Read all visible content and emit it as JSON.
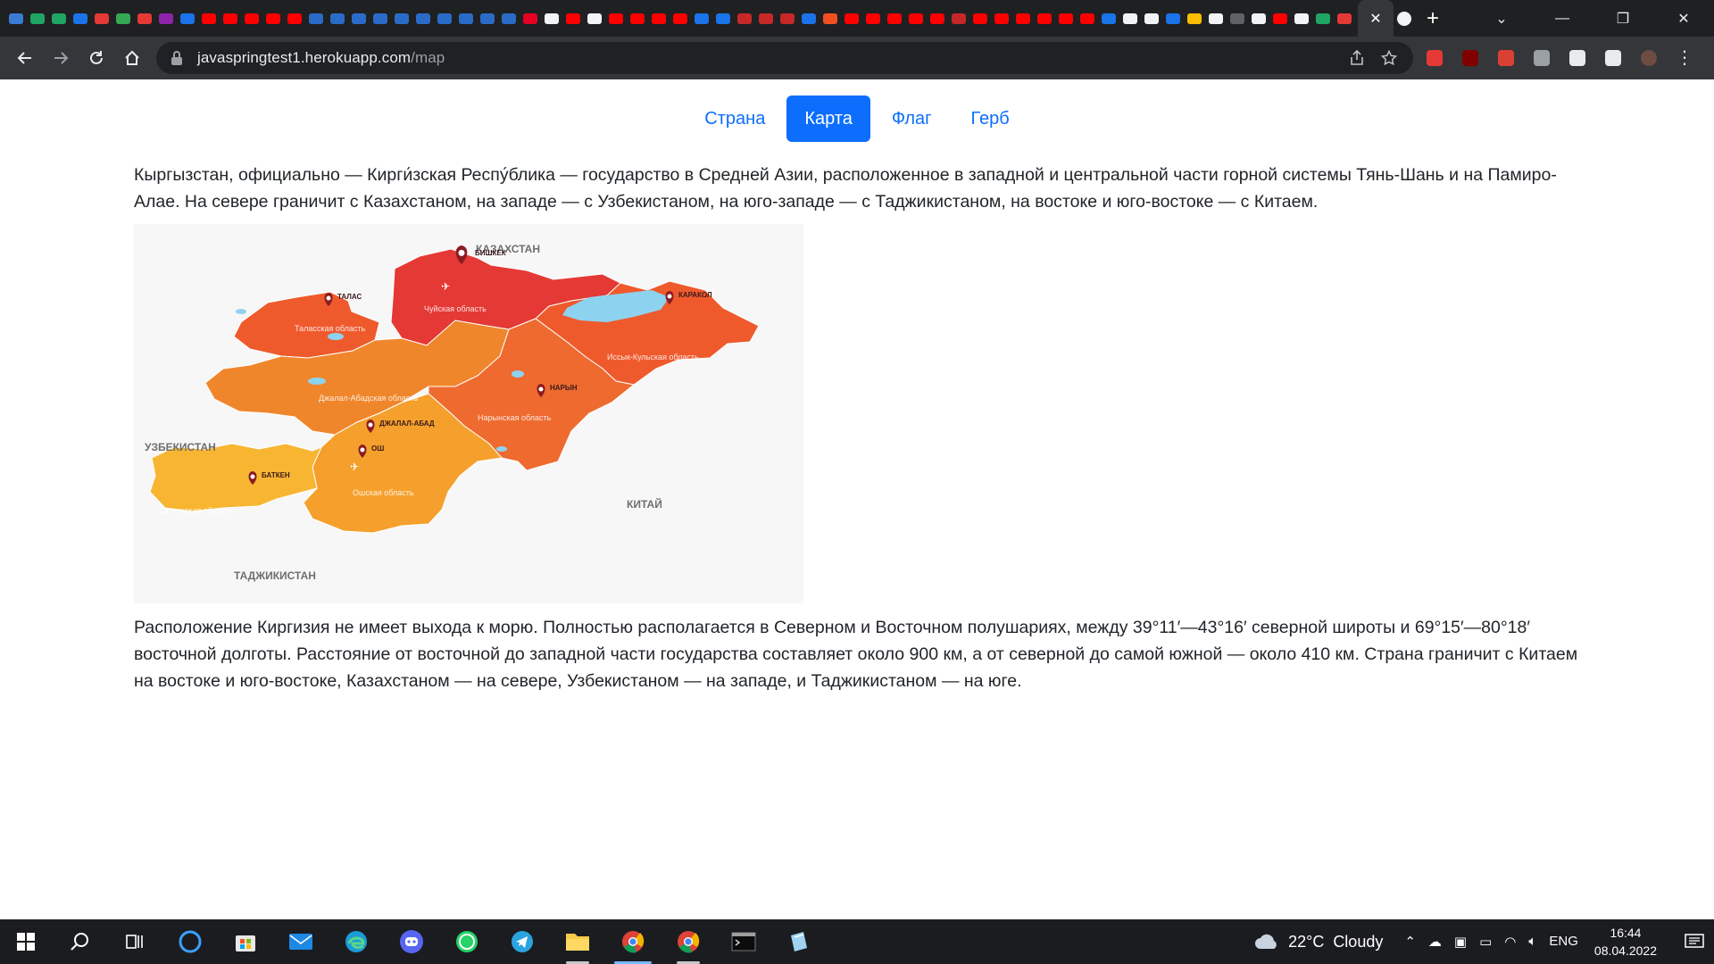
{
  "browser": {
    "active_tab_close": "✕",
    "new_tab": "+",
    "window_controls": {
      "dropdown": "⌄",
      "minimize": "—",
      "maximize": "❐",
      "close": "✕"
    },
    "url_host": "javaspringtest1.herokuapp.com",
    "url_path": "/map",
    "tab_favicon_colors": [
      "#3a7bd5",
      "#1fa463",
      "#1fa463",
      "#1a73e8",
      "#e53935",
      "#34a853",
      "#e53935",
      "#8e24aa",
      "#1a73e8",
      "#ff0000",
      "#ff0000",
      "#ff0000",
      "#ff0000",
      "#ff0000",
      "#2a6bc8",
      "#2a6bc8",
      "#2a6bc8",
      "#2a6bc8",
      "#2a6bc8",
      "#2a6bc8",
      "#2a6bc8",
      "#2a6bc8",
      "#2a6bc8",
      "#2a6bc8",
      "#e60023",
      "#f1f3f4",
      "#ff0000",
      "#f1f3f4",
      "#ff0000",
      "#ff0000",
      "#ff0000",
      "#ff0000",
      "#1a73e8",
      "#1a73e8",
      "#c62828",
      "#c62828",
      "#c62828",
      "#1a73e8",
      "#f25022",
      "#ff0000",
      "#ff0000",
      "#ff0000",
      "#ff0000",
      "#ff0000",
      "#c62828",
      "#ff0000",
      "#ff0000",
      "#ff0000",
      "#ff0000",
      "#ff0000",
      "#ff0000",
      "#1a73e8",
      "#f1f3f4",
      "#f1f3f4",
      "#1a73e8",
      "#fbbc04",
      "#f1f3f4",
      "#5f6368",
      "#f1f3f4",
      "#ff0000",
      "#f1f3f4",
      "#1fa463",
      "#e53935",
      "#ff0000",
      "#f57c00",
      "#f57c00",
      "#f1f3f4"
    ]
  },
  "extensions": [
    {
      "name": "adblock-icon",
      "color": "#e53935"
    },
    {
      "name": "ublock-icon",
      "color": "#800000"
    },
    {
      "name": "todoist-icon",
      "color": "#db4035"
    },
    {
      "name": "incognito-off-icon",
      "color": "#9aa0a6"
    },
    {
      "name": "extensions-puzzle-icon",
      "color": "#e8eaed"
    },
    {
      "name": "side-panel-icon",
      "color": "#e8eaed"
    },
    {
      "name": "profile-avatar",
      "color": "#6d4c41"
    }
  ],
  "nav": {
    "tabs": [
      {
        "label": "Страна",
        "active": false
      },
      {
        "label": "Карта",
        "active": true
      },
      {
        "label": "Флаг",
        "active": false
      },
      {
        "label": "Герб",
        "active": false
      }
    ]
  },
  "content": {
    "intro": "Кыргызстан, официально — Кирги́зская Респу́блика — государство в Средней Азии, расположенное в западной и центральной части горной системы Тянь-Шань и на Памиро-Алае. На севере граничит с Казахстаном, на западе — с Узбекистаном, на юго-западе — с Таджикистаном, на востоке и юго-востоке — с Китаем.",
    "location": "Расположение Киргизия не имеет выхода к морю. Полностью располагается в Северном и Восточном полушариях, между 39°11′—43°16′ северной широты и 69°15′—80°18′ восточной долготы. Расстояние от восточной до западной части государства составляет около 900 км, а от северной до самой южной — около 410 км. Страна граничит с Китаем на востоке и юго-востоке, Казахстаном — на севере, Узбекистаном — на западе, и Таджикистаном — на юге."
  },
  "map": {
    "countries": {
      "kazakhstan": "КАЗАХСТАН",
      "uzbekistan": "УЗБЕКИСТАН",
      "china": "КИТАЙ",
      "tajikistan": "ТАДЖИКИСТАН"
    },
    "cities": {
      "bishkek": "БИШКЕК",
      "talas": "ТАЛАС",
      "karakol": "КАРАКОЛ",
      "naryn": "НАРЫН",
      "jalalabad": "ДЖАЛАЛ-АБАД",
      "osh": "ОШ",
      "batken": "БАТКЕН"
    },
    "regions": {
      "chui": "Чуйская область",
      "talas": "Таласская область",
      "issykkul": "Иссык-Кульская область",
      "jalalabad": "Джалал-Абадская область",
      "naryn": "Нарынская область",
      "osh": "Ошская область",
      "batken": "Баткенская область"
    },
    "colors": {
      "chui": "#e53935",
      "talas": "#ef5a2d",
      "issykkul": "#ef5a2d",
      "jalalabad": "#f0862b",
      "naryn": "#ee6a2f",
      "osh": "#f5a02c",
      "batken": "#f7b531",
      "lake": "#8dd3f0",
      "pin": "#8b1c22"
    }
  },
  "taskbar": {
    "weather_temp": "22°C",
    "weather_desc": "Cloudy",
    "lang": "ENG",
    "time": "16:44",
    "date": "08.04.2022"
  }
}
